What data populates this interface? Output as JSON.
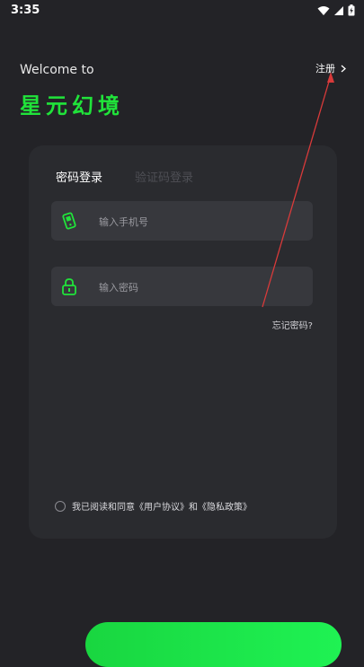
{
  "status_bar": {
    "time": "3:35"
  },
  "header": {
    "welcome": "Welcome to",
    "brand": "星元幻境",
    "register_label": "注册"
  },
  "login": {
    "tabs": [
      {
        "label": "密码登录",
        "active": true
      },
      {
        "label": "验证码登录",
        "active": false
      }
    ],
    "phone_placeholder": "输入手机号",
    "password_placeholder": "输入密码",
    "forgot_label": "忘记密码?",
    "agreement_text": "我已阅读和同意《用户协议》和《隐私政策》"
  },
  "colors": {
    "accent": "#20e33a",
    "background": "#232327",
    "card": "#2a2b2f",
    "field": "#37383d",
    "annotation_arrow": "#d83a3a"
  },
  "icons": [
    "wifi-icon",
    "signal-icon",
    "battery-icon",
    "chevron-right-icon",
    "phone-icon",
    "lock-icon"
  ]
}
